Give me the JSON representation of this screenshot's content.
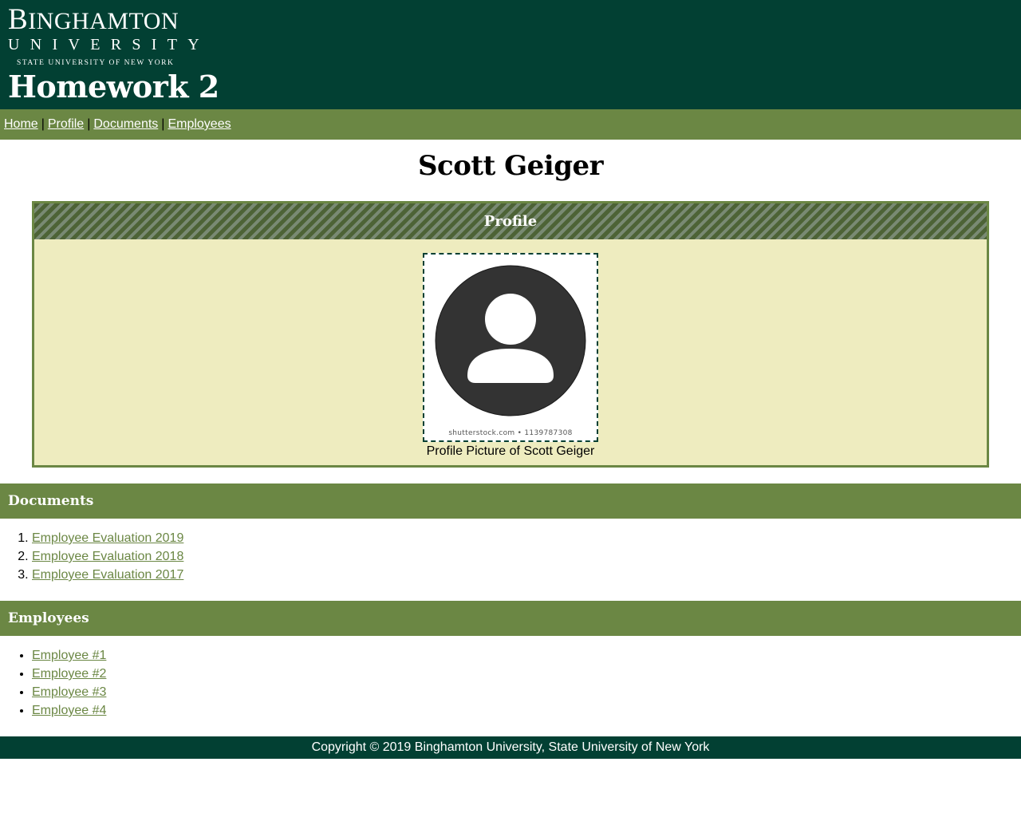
{
  "logo": {
    "line1": "Binghamton",
    "line2": "UNIVERSITY",
    "line3": "STATE UNIVERSITY OF NEW YORK"
  },
  "site_title": "Homework 2",
  "nav": {
    "items": [
      {
        "label": "Home"
      },
      {
        "label": "Profile"
      },
      {
        "label": "Documents"
      },
      {
        "label": "Employees"
      }
    ],
    "separator": "|"
  },
  "page_title": "Scott Geiger",
  "profile": {
    "header": "Profile",
    "watermark": "shutterstock.com • 1139787308",
    "caption": "Profile Picture of Scott Geiger",
    "icon": "user-avatar-icon"
  },
  "documents": {
    "header": "Documents",
    "items": [
      {
        "label": "Employee Evaluation 2019"
      },
      {
        "label": "Employee Evaluation 2018"
      },
      {
        "label": "Employee Evaluation 2017"
      }
    ]
  },
  "employees": {
    "header": "Employees",
    "items": [
      {
        "label": "Employee #1"
      },
      {
        "label": "Employee #2"
      },
      {
        "label": "Employee #3"
      },
      {
        "label": "Employee #4"
      }
    ]
  },
  "footer": {
    "text": "Copyright © 2019 Binghamton University, State University of New York"
  },
  "colors": {
    "dark_green": "#024033",
    "olive_green": "#6b8744",
    "panel_bg": "#eeecbf"
  }
}
